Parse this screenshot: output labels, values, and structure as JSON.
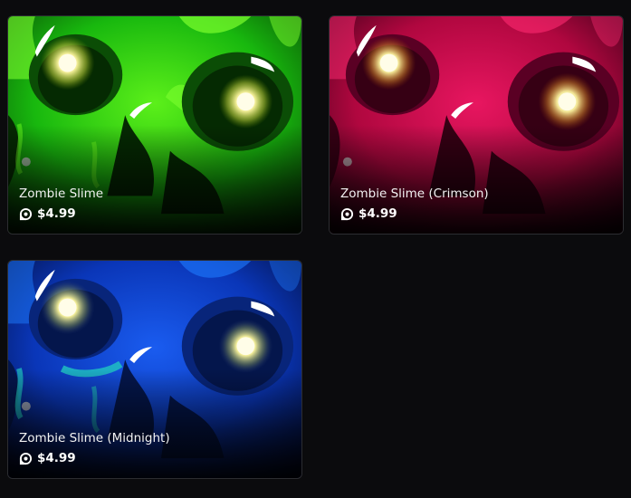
{
  "items": [
    {
      "name": "Zombie Slime",
      "price": "$4.99",
      "currency_icon": "robux-icon",
      "theme": {
        "base": "#1fd61a",
        "light": "#7dff2e",
        "dark": "#0a3d06",
        "deep": "#021500"
      }
    },
    {
      "name": "Zombie Slime (Crimson)",
      "price": "$4.99",
      "currency_icon": "robux-icon",
      "theme": {
        "base": "#c2084a",
        "light": "#ff2a72",
        "dark": "#4a0020",
        "deep": "#12000a"
      }
    },
    {
      "name": "Zombie Slime (Midnight)",
      "price": "$4.99",
      "currency_icon": "robux-icon",
      "theme": {
        "base": "#0a3fd0",
        "light": "#1e7bff",
        "dark": "#061a55",
        "deep": "#000617"
      }
    }
  ]
}
